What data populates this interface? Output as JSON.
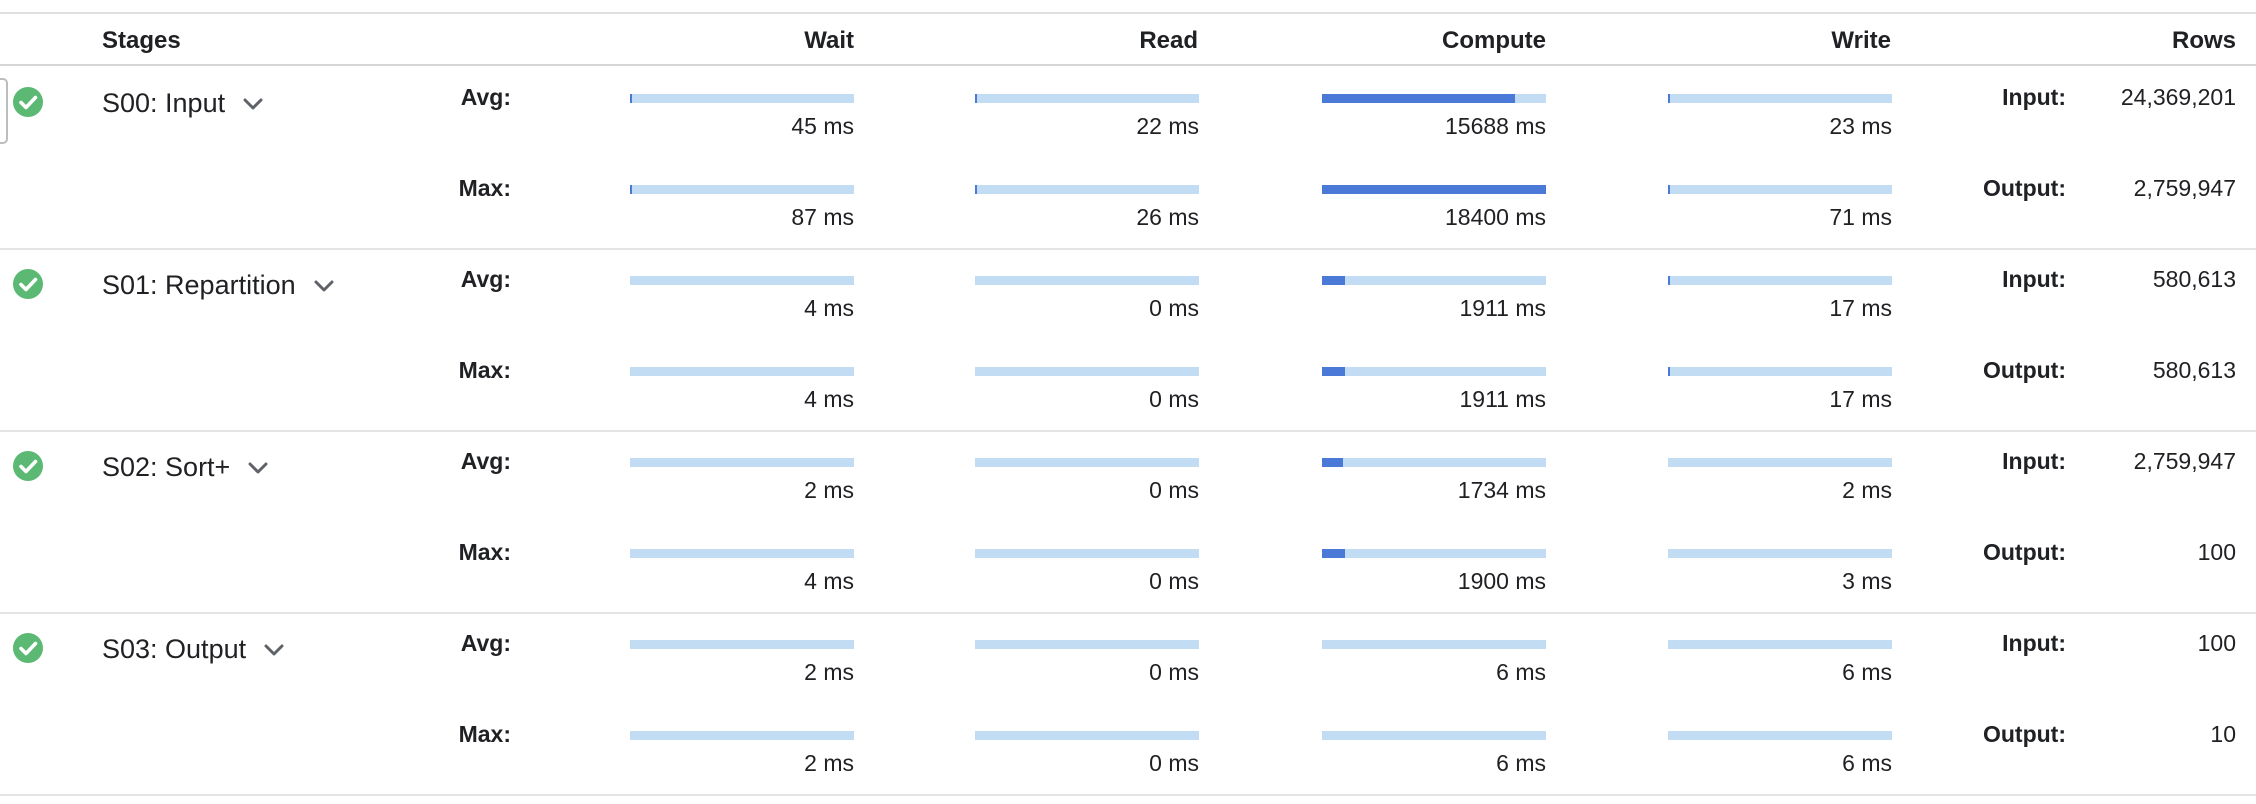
{
  "header": {
    "stages": "Stages",
    "wait": "Wait",
    "read": "Read",
    "compute": "Compute",
    "write": "Write",
    "rows": "Rows"
  },
  "labels": {
    "avg": "Avg:",
    "max": "Max:",
    "input": "Input:",
    "output": "Output:"
  },
  "colors": {
    "check": "#5bb974",
    "bar_track": "#c2dcf4",
    "bar_fill": "#4a79d8"
  },
  "stages": [
    {
      "name": "S00: Input",
      "status_icon": "check-circle-icon",
      "avg": {
        "wait": {
          "text": "45 ms",
          "fraction": 0.003
        },
        "read": {
          "text": "22 ms",
          "fraction": 0.001
        },
        "compute": {
          "text": "15688 ms",
          "fraction": 0.86
        },
        "write": {
          "text": "23 ms",
          "fraction": 0.001
        }
      },
      "max": {
        "wait": {
          "text": "87 ms",
          "fraction": 0.005
        },
        "read": {
          "text": "26 ms",
          "fraction": 0.001
        },
        "compute": {
          "text": "18400 ms",
          "fraction": 1.0
        },
        "write": {
          "text": "71 ms",
          "fraction": 0.004
        }
      },
      "rows": {
        "input": "24,369,201",
        "output": "2,759,947"
      }
    },
    {
      "name": "S01: Repartition",
      "status_icon": "check-circle-icon",
      "avg": {
        "wait": {
          "text": "4 ms",
          "fraction": 0.0
        },
        "read": {
          "text": "0 ms",
          "fraction": 0.0
        },
        "compute": {
          "text": "1911 ms",
          "fraction": 0.104
        },
        "write": {
          "text": "17 ms",
          "fraction": 0.001
        }
      },
      "max": {
        "wait": {
          "text": "4 ms",
          "fraction": 0.0
        },
        "read": {
          "text": "0 ms",
          "fraction": 0.0
        },
        "compute": {
          "text": "1911 ms",
          "fraction": 0.104
        },
        "write": {
          "text": "17 ms",
          "fraction": 0.001
        }
      },
      "rows": {
        "input": "580,613",
        "output": "580,613"
      }
    },
    {
      "name": "S02: Sort+",
      "status_icon": "check-circle-icon",
      "avg": {
        "wait": {
          "text": "2 ms",
          "fraction": 0.0
        },
        "read": {
          "text": "0 ms",
          "fraction": 0.0
        },
        "compute": {
          "text": "1734 ms",
          "fraction": 0.094
        },
        "write": {
          "text": "2 ms",
          "fraction": 0.0
        }
      },
      "max": {
        "wait": {
          "text": "4 ms",
          "fraction": 0.0
        },
        "read": {
          "text": "0 ms",
          "fraction": 0.0
        },
        "compute": {
          "text": "1900 ms",
          "fraction": 0.103
        },
        "write": {
          "text": "3 ms",
          "fraction": 0.0
        }
      },
      "rows": {
        "input": "2,759,947",
        "output": "100"
      }
    },
    {
      "name": "S03: Output",
      "status_icon": "check-circle-icon",
      "avg": {
        "wait": {
          "text": "2 ms",
          "fraction": 0.0
        },
        "read": {
          "text": "0 ms",
          "fraction": 0.0
        },
        "compute": {
          "text": "6 ms",
          "fraction": 0.0
        },
        "write": {
          "text": "6 ms",
          "fraction": 0.0
        }
      },
      "max": {
        "wait": {
          "text": "2 ms",
          "fraction": 0.0
        },
        "read": {
          "text": "0 ms",
          "fraction": 0.0
        },
        "compute": {
          "text": "6 ms",
          "fraction": 0.0
        },
        "write": {
          "text": "6 ms",
          "fraction": 0.0
        }
      },
      "rows": {
        "input": "100",
        "output": "10"
      }
    }
  ]
}
